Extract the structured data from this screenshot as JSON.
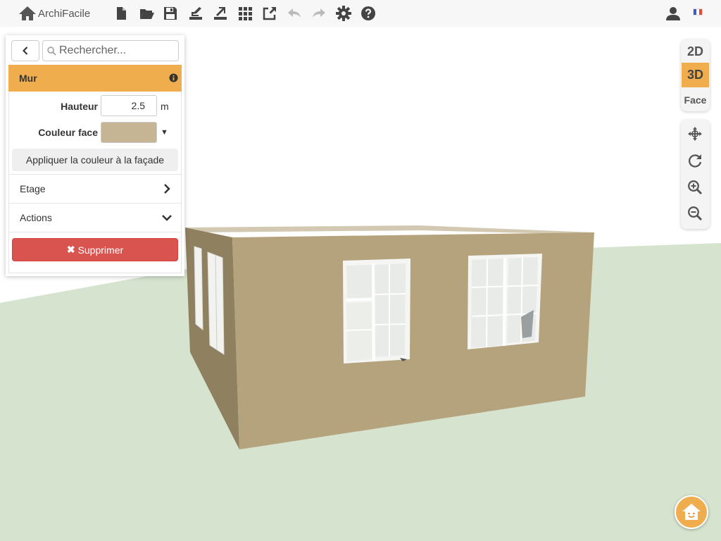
{
  "app": {
    "name": "ArchiFacile"
  },
  "toolbar": {
    "buttons": [
      "new-file-icon",
      "open-folder-icon",
      "save-icon",
      "import-icon",
      "export-icon",
      "grid-icon",
      "share-icon",
      "undo-icon",
      "redo-icon",
      "settings-icon",
      "help-icon"
    ]
  },
  "panel": {
    "search_placeholder": "Rechercher...",
    "section_title": "Mur",
    "height_label": "Hauteur",
    "height_value": "2.5",
    "height_unit": "m",
    "color_label": "Couleur face",
    "color_value": "#c6b594",
    "apply_label": "Appliquer la couleur à la façade",
    "floor_label": "Etage",
    "actions_label": "Actions",
    "delete_label": "Supprimer"
  },
  "views": {
    "v2d": "2D",
    "v3d": "3D",
    "face": "Face",
    "active": "3D"
  },
  "colors": {
    "accent": "#f0ad4e",
    "danger": "#d9534f",
    "ground": "#d5e3cf",
    "wall": "#b5a37e"
  }
}
